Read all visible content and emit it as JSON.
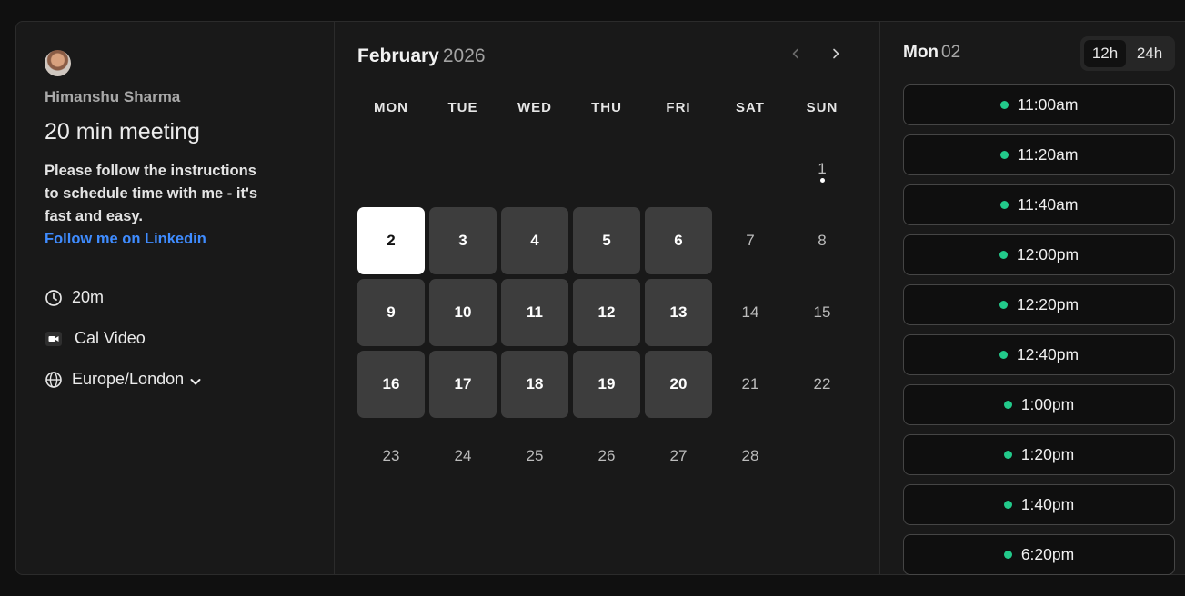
{
  "profile": {
    "host_name": "Himanshu Sharma",
    "event_title": "20 min meeting",
    "description_lines": [
      "Please follow the instructions",
      "to schedule time with me - it's",
      "fast and easy."
    ],
    "link_text": "Follow me on Linkedin",
    "duration": "20m",
    "location": "Cal Video",
    "timezone": "Europe/London"
  },
  "calendar": {
    "month": "February",
    "year": "2026",
    "weekdays": [
      "MON",
      "TUE",
      "WED",
      "THU",
      "FRI",
      "SAT",
      "SUN"
    ],
    "days": [
      {
        "label": "1",
        "state": "plain",
        "dot": true
      },
      {
        "label": "2",
        "state": "selected"
      },
      {
        "label": "3",
        "state": "available"
      },
      {
        "label": "4",
        "state": "available"
      },
      {
        "label": "5",
        "state": "available"
      },
      {
        "label": "6",
        "state": "available"
      },
      {
        "label": "7",
        "state": "plain"
      },
      {
        "label": "8",
        "state": "plain"
      },
      {
        "label": "9",
        "state": "available"
      },
      {
        "label": "10",
        "state": "available"
      },
      {
        "label": "11",
        "state": "available"
      },
      {
        "label": "12",
        "state": "available"
      },
      {
        "label": "13",
        "state": "available"
      },
      {
        "label": "14",
        "state": "plain"
      },
      {
        "label": "15",
        "state": "plain"
      },
      {
        "label": "16",
        "state": "available"
      },
      {
        "label": "17",
        "state": "available"
      },
      {
        "label": "18",
        "state": "available"
      },
      {
        "label": "19",
        "state": "available"
      },
      {
        "label": "20",
        "state": "available"
      },
      {
        "label": "21",
        "state": "plain"
      },
      {
        "label": "22",
        "state": "plain"
      },
      {
        "label": "23",
        "state": "plain"
      },
      {
        "label": "24",
        "state": "plain"
      },
      {
        "label": "25",
        "state": "plain"
      },
      {
        "label": "26",
        "state": "plain"
      },
      {
        "label": "27",
        "state": "plain"
      },
      {
        "label": "28",
        "state": "plain"
      }
    ]
  },
  "slots": {
    "day_name": "Mon",
    "day_num": "02",
    "format_options": [
      "12h",
      "24h"
    ],
    "format_selected": "12h",
    "times": [
      "11:00am",
      "11:20am",
      "11:40am",
      "12:00pm",
      "12:20pm",
      "12:40pm",
      "1:00pm",
      "1:20pm",
      "1:40pm",
      "6:20pm"
    ]
  },
  "colors": {
    "available_dot": "#22c98a",
    "link": "#3f8cff",
    "selected_day": "#ffffff"
  },
  "icons": {
    "duration": "clock-icon",
    "location": "video-camera-icon",
    "timezone": "globe-icon",
    "timezone_toggle": "chevron-down-icon",
    "prev": "chevron-left-icon",
    "next": "chevron-right-icon"
  }
}
